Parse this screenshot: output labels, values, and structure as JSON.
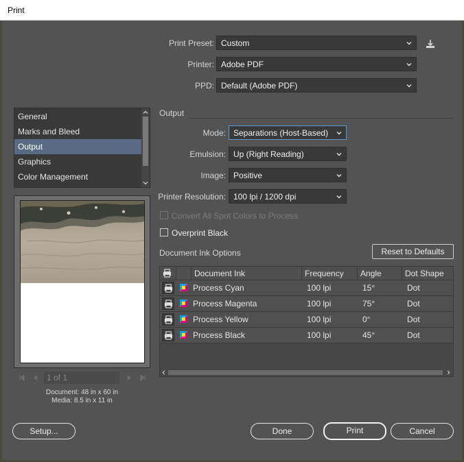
{
  "window": {
    "title": "Print"
  },
  "preset": {
    "print_preset_label": "Print Preset:",
    "print_preset_value": "Custom",
    "printer_label": "Printer:",
    "printer_value": "Adobe PDF",
    "ppd_label": "PPD:",
    "ppd_value": "Default (Adobe PDF)",
    "save_preset_icon": "save-preset-icon"
  },
  "sidebar": {
    "items": [
      {
        "label": "General",
        "selected": false
      },
      {
        "label": "Marks and Bleed",
        "selected": false
      },
      {
        "label": "Output",
        "selected": true
      },
      {
        "label": "Graphics",
        "selected": false
      },
      {
        "label": "Color Management",
        "selected": false
      }
    ]
  },
  "preview": {
    "page_field": "1 of 1",
    "document_info": "Document: 48 in x 60 in",
    "media_info": "Media: 8.5 in x 11 in",
    "image_fraction_of_page": 0.51
  },
  "output": {
    "section_title": "Output",
    "mode_label": "Mode:",
    "mode_value": "Separations (Host-Based)",
    "emulsion_label": "Emulsion:",
    "emulsion_value": "Up (Right Reading)",
    "image_label": "Image:",
    "image_value": "Positive",
    "resolution_label": "Printer Resolution:",
    "resolution_value": "100 lpi / 1200 dpi",
    "convert_spot_label": "Convert All Spot Colors to Process",
    "convert_spot_checked": false,
    "convert_spot_disabled": true,
    "overprint_label": "Overprint Black",
    "overprint_checked": false
  },
  "ink_options": {
    "section_title": "Document Ink Options",
    "reset_button": "Reset to Defaults",
    "columns": [
      "Document Ink",
      "Frequency",
      "Angle",
      "Dot Shape"
    ],
    "rows": [
      {
        "ink": "Process Cyan",
        "frequency": "100 lpi",
        "angle": "15°",
        "dot": "Dot"
      },
      {
        "ink": "Process Magenta",
        "frequency": "100 lpi",
        "angle": "75°",
        "dot": "Dot"
      },
      {
        "ink": "Process Yellow",
        "frequency": "100 lpi",
        "angle": "0°",
        "dot": "Dot"
      },
      {
        "ink": "Process Black",
        "frequency": "100 lpi",
        "angle": "45°",
        "dot": "Dot"
      }
    ]
  },
  "footer": {
    "setup_button": "Setup...",
    "done_button": "Done",
    "print_button": "Print",
    "cancel_button": "Cancel"
  },
  "colors": {
    "background": "#535353",
    "selected_item": "#596b82",
    "focus_ring": "#5b9bd5"
  }
}
